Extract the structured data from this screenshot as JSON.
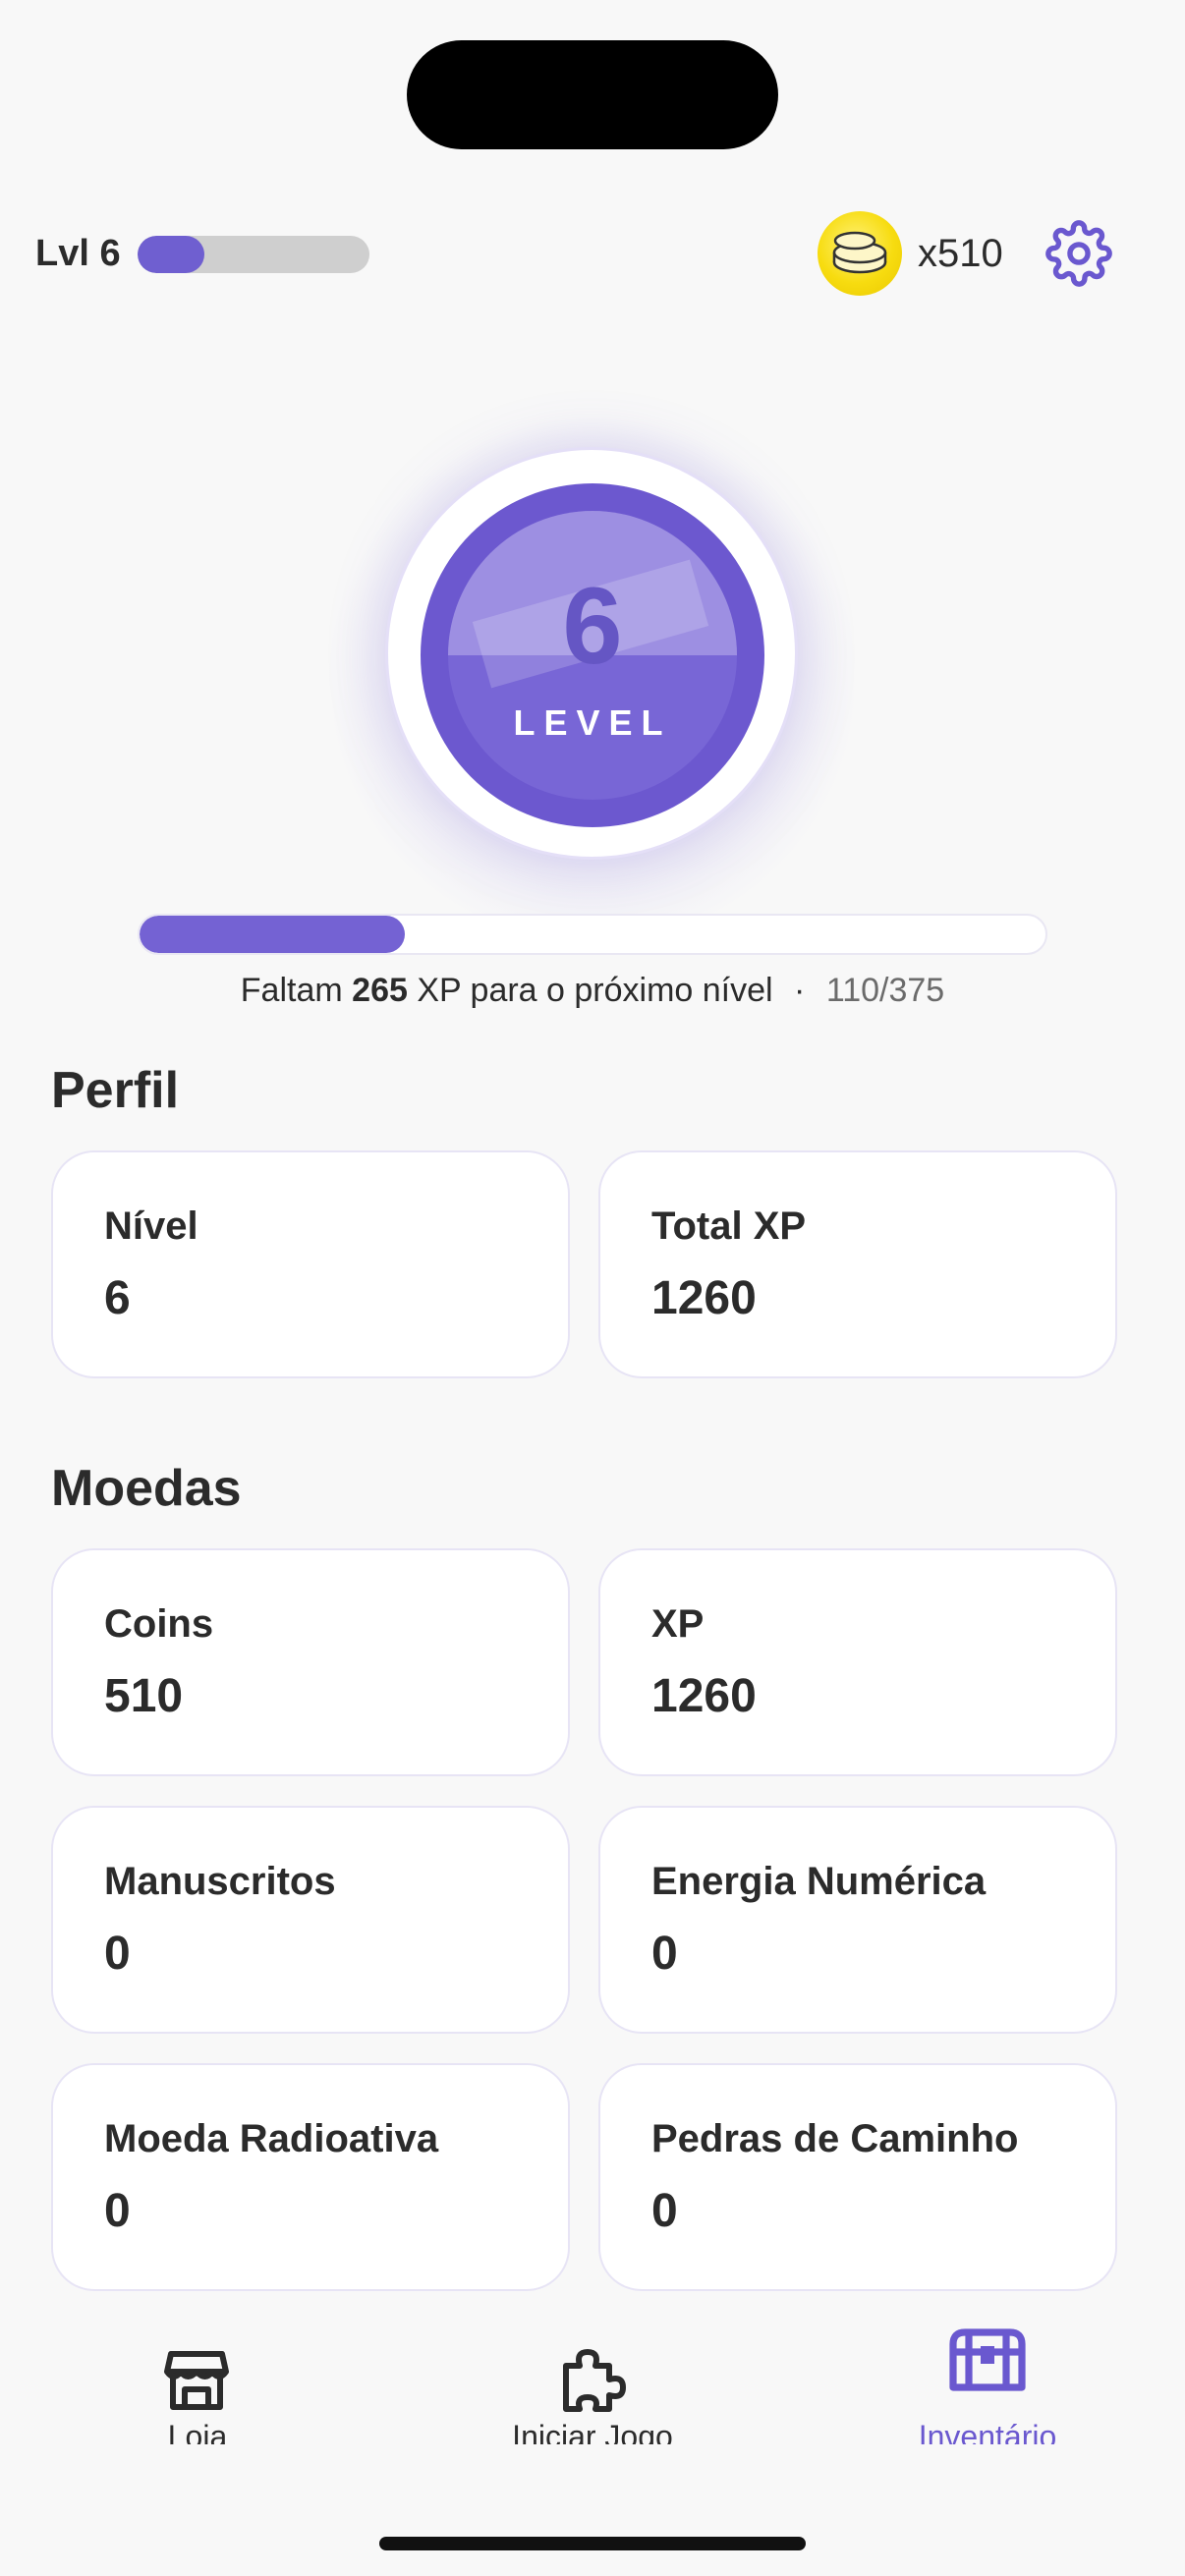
{
  "header": {
    "level_label": "Lvl 6",
    "level_progress_fraction": 0.29,
    "coin_count": "x510",
    "coin_icon": "coin-stack-icon",
    "settings_icon": "gear-icon"
  },
  "level_badge": {
    "number": "6",
    "label": "LEVEL"
  },
  "progress": {
    "prefix": "Faltam",
    "xp_remaining": "265",
    "suffix": "XP para o próximo nível",
    "separator": "·",
    "count": "110/375",
    "fraction": 0.293
  },
  "profile": {
    "title": "Perfil",
    "cards": [
      {
        "label": "Nível",
        "value": "6"
      },
      {
        "label": "Total XP",
        "value": "1260"
      }
    ]
  },
  "currencies": {
    "title": "Moedas",
    "cards": [
      {
        "label": "Coins",
        "value": "510"
      },
      {
        "label": "XP",
        "value": "1260"
      },
      {
        "label": "Manuscritos",
        "value": "0"
      },
      {
        "label": "Energia Numérica",
        "value": "0"
      },
      {
        "label": "Moeda Radioativa",
        "value": "0"
      },
      {
        "label": "Pedras de Caminho",
        "value": "0"
      }
    ]
  },
  "tabbar": {
    "items": [
      {
        "label": "Loja",
        "icon": "store-icon",
        "active": false
      },
      {
        "label": "Iniciar Jogo",
        "icon": "puzzle-icon",
        "active": false
      },
      {
        "label": "Inventário",
        "icon": "treasure-chest-icon",
        "active": true
      }
    ]
  },
  "colors": {
    "accent": "#6c58cf",
    "background": "#f8f8f8",
    "coin": "#f7dc10"
  }
}
